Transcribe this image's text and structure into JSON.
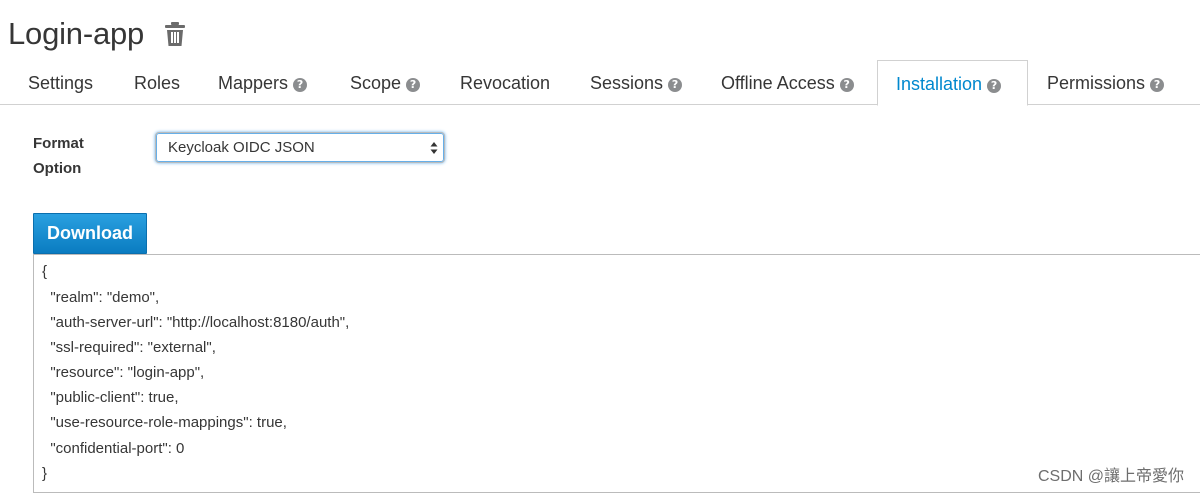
{
  "header": {
    "title": "Login-app",
    "delete_icon": "trash-icon"
  },
  "tabs": [
    {
      "label": "Settings",
      "help": false
    },
    {
      "label": "Roles",
      "help": false
    },
    {
      "label": "Mappers",
      "help": true
    },
    {
      "label": "Scope",
      "help": true
    },
    {
      "label": "Revocation",
      "help": false
    },
    {
      "label": "Sessions",
      "help": true
    },
    {
      "label": "Offline Access",
      "help": true
    },
    {
      "label": "Installation",
      "help": true,
      "active": true
    },
    {
      "label": "Permissions",
      "help": true
    }
  ],
  "help_glyph": "?",
  "form": {
    "label_line1": "Format",
    "label_line2": "Option",
    "selected": "Keycloak OIDC JSON"
  },
  "download_label": "Download",
  "code_lines": [
    "{",
    "  \"realm\": \"demo\",",
    "  \"auth-server-url\": \"http://localhost:8180/auth\",",
    "  \"ssl-required\": \"external\",",
    "  \"resource\": \"login-app\",",
    "  \"public-client\": true,",
    "  \"use-resource-role-mappings\": true,",
    "  \"confidential-port\": 0",
    "}"
  ],
  "watermark": "CSDN @讓上帝愛你",
  "colors": {
    "active_tab": "#0088ce",
    "button": "#1a8fd0"
  }
}
